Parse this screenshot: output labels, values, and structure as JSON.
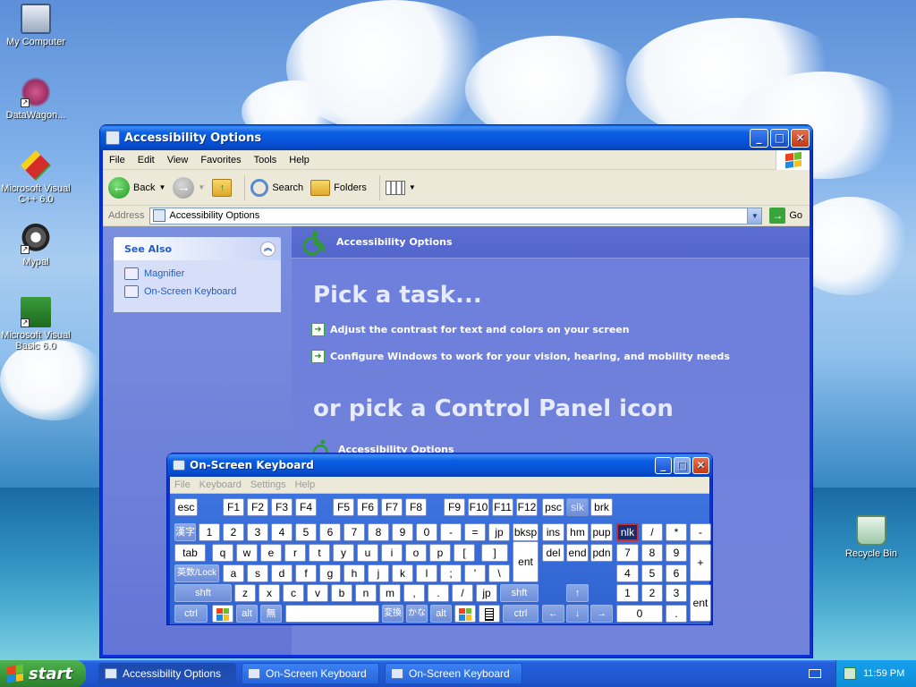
{
  "desktop": {
    "icons": [
      {
        "label": "My Computer"
      },
      {
        "label": "DataWagon..."
      },
      {
        "label": "Microsoft Visual C++ 6.0"
      },
      {
        "label": "Mypal"
      },
      {
        "label": "Microsoft Visual Basic 6.0"
      },
      {
        "label": "Recycle Bin"
      }
    ]
  },
  "explorer": {
    "title": "Accessibility Options",
    "menu": [
      "File",
      "Edit",
      "View",
      "Favorites",
      "Tools",
      "Help"
    ],
    "toolbar": {
      "back": "Back",
      "search": "Search",
      "folders": "Folders"
    },
    "address": {
      "label": "Address",
      "value": "Accessibility Options",
      "go": "Go"
    },
    "see_also": {
      "title": "See Also",
      "items": [
        "Magnifier",
        "On-Screen Keyboard"
      ]
    },
    "header": "Accessibility Options",
    "pick_task": "Pick a task...",
    "tasks": [
      "Adjust the contrast for text and colors on your screen",
      "Configure Windows to work for your vision, hearing, and mobility needs"
    ],
    "pick_icon": "or pick a Control Panel icon",
    "cp_item": "Accessibility Options"
  },
  "osk": {
    "title": "On-Screen Keyboard",
    "menu": [
      "File",
      "Keyboard",
      "Settings",
      "Help"
    ],
    "keys": {
      "esc": "esc",
      "f1": "F1",
      "f2": "F2",
      "f3": "F3",
      "f4": "F4",
      "f5": "F5",
      "f6": "F6",
      "f7": "F7",
      "f8": "F8",
      "f9": "F9",
      "f10": "F10",
      "f11": "F11",
      "f12": "F12",
      "psc": "psc",
      "slk": "slk",
      "brk": "brk",
      "kanji": "漢字",
      "n1": "1",
      "n2": "2",
      "n3": "3",
      "n4": "4",
      "n5": "5",
      "n6": "6",
      "n7": "7",
      "n8": "8",
      "n9": "9",
      "n0": "0",
      "minus": "-",
      "equals": "=",
      "jp": "jp",
      "bksp": "bksp",
      "ins": "ins",
      "hm": "hm",
      "pup": "pup",
      "nlk": "nlk",
      "slash": "/",
      "star": "*",
      "kpminus": "-",
      "tab": "tab",
      "q": "q",
      "w": "w",
      "e": "e",
      "r": "r",
      "t": "t",
      "y": "y",
      "u": "u",
      "i": "i",
      "o": "o",
      "p": "p",
      "lbr": "[",
      "rbr": "]",
      "del": "del",
      "end": "end",
      "pdn": "pdn",
      "k7": "7",
      "k8": "8",
      "k9": "9",
      "kpplus": "+",
      "eisu": "英数/Lock",
      "a": "a",
      "s": "s",
      "d": "d",
      "f": "f",
      "g": "g",
      "h": "h",
      "j": "j",
      "k": "k",
      "l": "l",
      "semi": ";",
      "quote": "'",
      "bslash": "\\",
      "ent": "ent",
      "k4": "4",
      "k5": "5",
      "k6": "6",
      "lshift": "shft",
      "z": "z",
      "x": "x",
      "c": "c",
      "v": "v",
      "b": "b",
      "n": "n",
      "m": "m",
      "comma": ",",
      "period": ".",
      "fslash": "/",
      "jp2": "jp",
      "rshift": "shft",
      "up": "↑",
      "k1": "1",
      "k2": "2",
      "k3": "3",
      "kpent": "ent",
      "lctrl": "ctrl",
      "lalt": "alt",
      "muhenkan": "無",
      "henkan": "変換",
      "kana": "かな",
      "ralt": "alt",
      "rctrl": "ctrl",
      "left": "←",
      "down": "↓",
      "right": "→",
      "k0": "0",
      "kpdot": "."
    }
  },
  "taskbar": {
    "start": "start",
    "tasks": [
      "Accessibility Options",
      "On-Screen Keyboard",
      "On-Screen Keyboard"
    ],
    "clock": "11:59 PM"
  },
  "colors": {
    "title_blue": "#0a5fe4",
    "start_green": "#3a9b3a",
    "pane_blue": "#6d7fdb"
  }
}
